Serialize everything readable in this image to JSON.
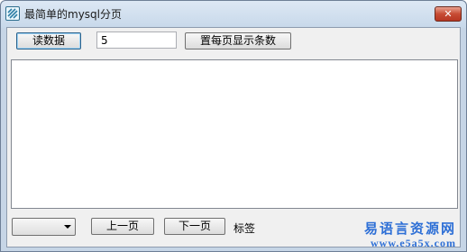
{
  "window": {
    "title": "最简单的mysql分页",
    "close_label": "✕",
    "app_icon": "app-icon"
  },
  "toolbar": {
    "read_button": "读数据",
    "page_size_value": "5",
    "set_page_size_button": "置每页显示条数"
  },
  "footer": {
    "combo_value": "",
    "prev_button": "上一页",
    "next_button": "下一页",
    "label": "标签"
  },
  "watermark": {
    "line1": "易语言资源网",
    "line2": "www.e5a5x.com"
  }
}
